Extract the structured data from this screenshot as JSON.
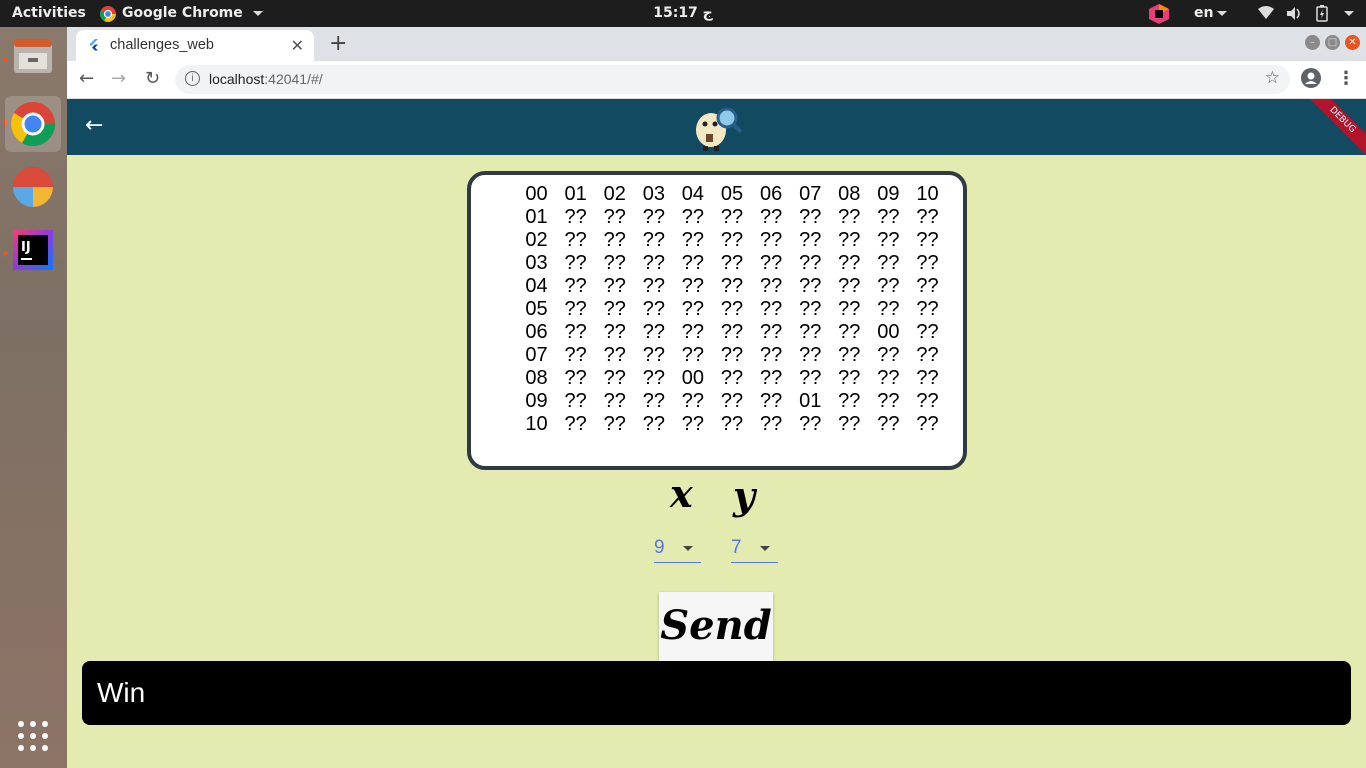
{
  "system_bar": {
    "activities": "Activities",
    "app_name": "Google Chrome",
    "clock": "15:17 ج",
    "language": "en"
  },
  "browser": {
    "tab_title": "challenges_web",
    "url_host": "localhost",
    "url_rest": ":42041/#/"
  },
  "app": {
    "debug_banner": "DEBUG",
    "grid_rows": [
      [
        "00",
        "01",
        "02",
        "03",
        "04",
        "05",
        "06",
        "07",
        "08",
        "09",
        "10"
      ],
      [
        "01",
        "??",
        "??",
        "??",
        "??",
        "??",
        "??",
        "??",
        "??",
        "??",
        "??"
      ],
      [
        "02",
        "??",
        "??",
        "??",
        "??",
        "??",
        "??",
        "??",
        "??",
        "??",
        "??"
      ],
      [
        "03",
        "??",
        "??",
        "??",
        "??",
        "??",
        "??",
        "??",
        "??",
        "??",
        "??"
      ],
      [
        "04",
        "??",
        "??",
        "??",
        "??",
        "??",
        "??",
        "??",
        "??",
        "??",
        "??"
      ],
      [
        "05",
        "??",
        "??",
        "??",
        "??",
        "??",
        "??",
        "??",
        "??",
        "??",
        "??"
      ],
      [
        "06",
        "??",
        "??",
        "??",
        "??",
        "??",
        "??",
        "??",
        "??",
        "00",
        "??"
      ],
      [
        "07",
        "??",
        "??",
        "??",
        "??",
        "??",
        "??",
        "??",
        "??",
        "??",
        "??"
      ],
      [
        "08",
        "??",
        "??",
        "??",
        "00",
        "??",
        "??",
        "??",
        "??",
        "??",
        "??"
      ],
      [
        "09",
        "??",
        "??",
        "??",
        "??",
        "??",
        "??",
        "01",
        "??",
        "??",
        "??"
      ],
      [
        "10",
        "??",
        "??",
        "??",
        "??",
        "??",
        "??",
        "??",
        "??",
        "??",
        "??"
      ]
    ],
    "x_label": "x",
    "y_label": "y",
    "x_value": "9",
    "y_value": "7",
    "send_label": "Send",
    "snackbar_text": "Win"
  }
}
